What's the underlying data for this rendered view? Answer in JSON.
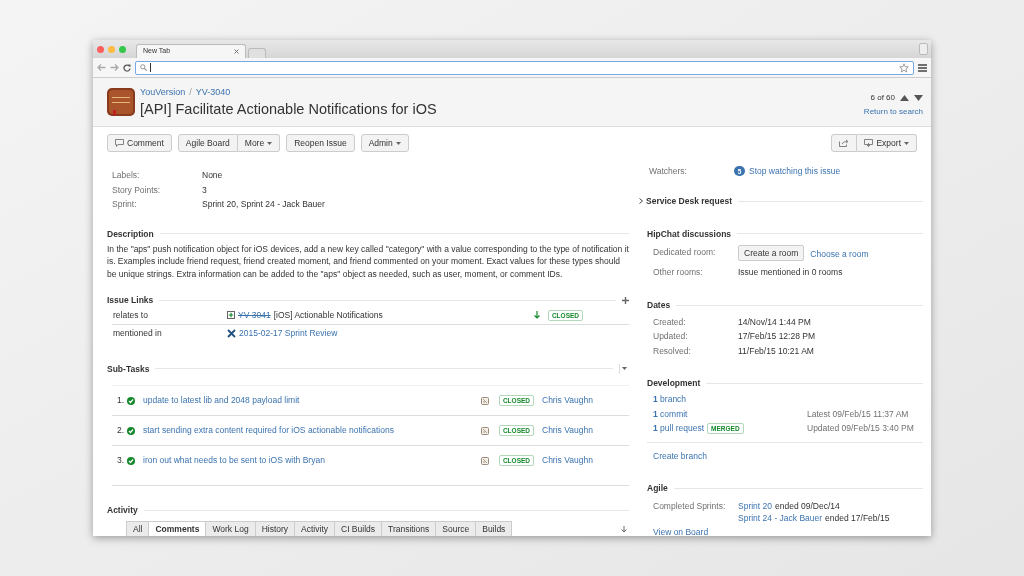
{
  "browser": {
    "tab_title": "New Tab"
  },
  "header": {
    "project": "YouVersion",
    "separator": "/",
    "issue_key": "YV-3040",
    "title": "[API] Facilitate Actionable Notifications for iOS",
    "counter": "6 of 60",
    "return_link": "Return to search"
  },
  "toolbar": {
    "groups": [
      [
        {
          "label": "Comment",
          "kind": "comment"
        }
      ],
      [
        {
          "label": "Agile Board",
          "kind": "plain"
        },
        {
          "label": "More",
          "kind": "dropdown"
        }
      ],
      [
        {
          "label": "Reopen Issue",
          "kind": "plain"
        }
      ],
      [
        {
          "label": "Admin",
          "kind": "dropdown"
        }
      ]
    ],
    "right": [
      {
        "kind": "share"
      },
      {
        "label": "Export",
        "kind": "export"
      }
    ]
  },
  "details": [
    {
      "label": "Labels:",
      "value": "None"
    },
    {
      "label": "Story Points:",
      "value": "3"
    },
    {
      "label": "Sprint:",
      "value": "Sprint 20, Sprint 24 - Jack Bauer"
    }
  ],
  "description": {
    "heading": "Description",
    "text": "In the \"aps\" push notification object for iOS devices, add a new key called \"category\" with a value corresponding to the type of notification it is. Examples include friend request, friend created moment, and friend commented on your moment. Exact values for these types should be unique strings. Extra information can be added to the \"aps\" object as needed, such as user, moment, or comment IDs."
  },
  "issue_links": {
    "heading": "Issue Links",
    "rows": [
      {
        "relation": "relates to",
        "kind": "issue",
        "key": "YV-3041",
        "resolved": true,
        "summary": "[iOS] Actionable Notifications",
        "status": "CLOSED"
      },
      {
        "relation": "mentioned in",
        "kind": "confluence",
        "summary": "2015-02-17 Sprint Review"
      }
    ]
  },
  "sub_tasks": {
    "heading": "Sub-Tasks",
    "items": [
      {
        "number": "1.",
        "summary": "update to latest lib and 2048 payload limit",
        "status": "CLOSED",
        "assignee": "Chris Vaughn"
      },
      {
        "number": "2.",
        "summary": "start sending extra content required for iOS actionable notifications",
        "status": "CLOSED",
        "assignee": "Chris Vaughn"
      },
      {
        "number": "3.",
        "summary": "iron out what needs to be sent to iOS with Bryan",
        "status": "CLOSED",
        "assignee": "Chris Vaughn"
      }
    ]
  },
  "activity": {
    "heading": "Activity",
    "tabs": [
      {
        "label": "All",
        "selected": false
      },
      {
        "label": "Comments",
        "selected": true
      },
      {
        "label": "Work Log",
        "selected": false
      },
      {
        "label": "History",
        "selected": false
      },
      {
        "label": "Activity",
        "selected": false
      },
      {
        "label": "CI Builds",
        "selected": false
      },
      {
        "label": "Transitions",
        "selected": false
      },
      {
        "label": "Source",
        "selected": false
      },
      {
        "label": "Builds",
        "selected": false
      }
    ]
  },
  "people": {
    "watchers_label": "Watchers:",
    "watchers_count": "5",
    "watchers_link": "Stop watching this issue"
  },
  "service_desk": {
    "heading": "Service Desk request",
    "expanded": false
  },
  "hipchat": {
    "heading": "HipChat discussions",
    "dedicated_label": "Dedicated room:",
    "create_button": "Create a room",
    "choose_link": "Choose a room",
    "other_label": "Other rooms:",
    "other_value": "Issue mentioned in 0 rooms"
  },
  "dates": {
    "heading": "Dates",
    "rows": [
      {
        "label": "Created:",
        "value": "14/Nov/14 1:44 PM"
      },
      {
        "label": "Updated:",
        "value": "17/Feb/15 12:28 PM"
      },
      {
        "label": "Resolved:",
        "value": "11/Feb/15 10:21 AM"
      }
    ]
  },
  "development": {
    "heading": "Development",
    "items": [
      {
        "count": "1",
        "label": "branch"
      },
      {
        "count": "1",
        "label": "commit",
        "detail": "Latest 09/Feb/15 11:37 AM"
      },
      {
        "count": "1",
        "label": "pull request",
        "badge": "MERGED",
        "detail": "Updated 09/Feb/15 3:40 PM"
      }
    ],
    "create_link": "Create branch"
  },
  "agile": {
    "heading": "Agile",
    "label": "Completed Sprints:",
    "sprints": [
      {
        "link": "Sprint 20",
        "rest": "ended 09/Dec/14"
      },
      {
        "link": "Sprint 24 - Jack Bauer",
        "rest": "ended 17/Feb/15"
      }
    ],
    "board_link": "View on Board"
  }
}
